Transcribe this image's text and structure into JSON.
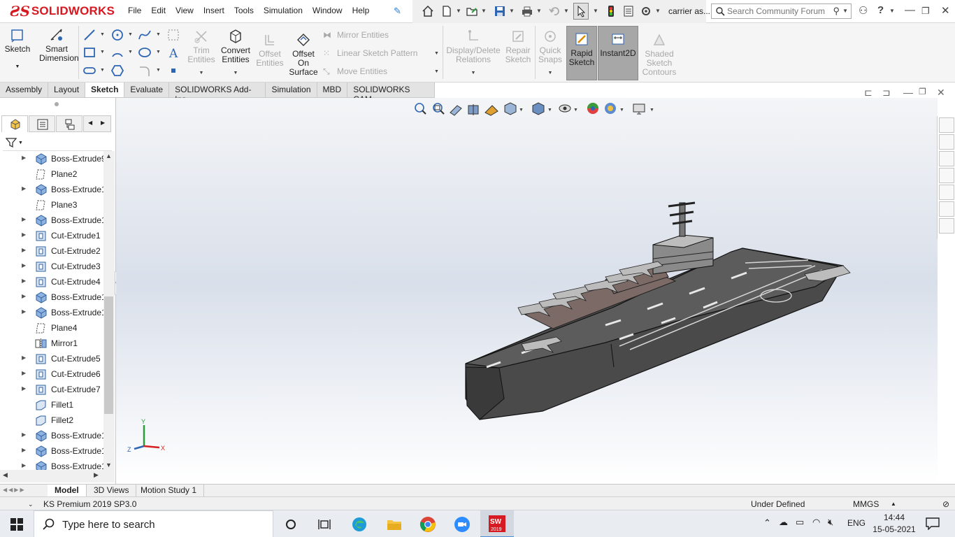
{
  "app": {
    "brand": "SOLIDWORKS",
    "menus": [
      "File",
      "Edit",
      "View",
      "Insert",
      "Tools",
      "Simulation",
      "Window",
      "Help"
    ],
    "document_title": "carrier as...",
    "search_placeholder": "Search Community Forum"
  },
  "command_manager": {
    "sketch": "Sketch",
    "smart_dimension": [
      "Smart",
      "Dimension"
    ],
    "trim_entities": [
      "Trim",
      "Entities"
    ],
    "convert_entities": [
      "Convert",
      "Entities"
    ],
    "offset_entities": [
      "Offset",
      "Entities"
    ],
    "offset_on_surface": [
      "Offset",
      "On",
      "Surface"
    ],
    "mirror_entities": "Mirror Entities",
    "linear_sketch_pattern": "Linear Sketch Pattern",
    "move_entities": "Move Entities",
    "display_delete_relations": [
      "Display/Delete",
      "Relations"
    ],
    "repair_sketch": [
      "Repair",
      "Sketch"
    ],
    "quick_snaps": [
      "Quick",
      "Snaps"
    ],
    "rapid_sketch": [
      "Rapid",
      "Sketch"
    ],
    "instant2d": "Instant2D",
    "shaded_sketch_contours": [
      "Shaded",
      "Sketch",
      "Contours"
    ]
  },
  "tabs": [
    {
      "label": "Assembly",
      "active": false
    },
    {
      "label": "Layout",
      "active": false
    },
    {
      "label": "Sketch",
      "active": true
    },
    {
      "label": "Evaluate",
      "active": false
    },
    {
      "label": "SOLIDWORKS Add-Ins",
      "active": false
    },
    {
      "label": "Simulation",
      "active": false
    },
    {
      "label": "MBD",
      "active": false
    },
    {
      "label": "SOLIDWORKS CAM",
      "active": false
    }
  ],
  "feature_tree": [
    {
      "label": "Boss-Extrude9",
      "type": "boss",
      "expandable": true
    },
    {
      "label": "Plane2",
      "type": "plane",
      "expandable": false
    },
    {
      "label": "Boss-Extrude1",
      "type": "boss",
      "expandable": true
    },
    {
      "label": "Plane3",
      "type": "plane",
      "expandable": false
    },
    {
      "label": "Boss-Extrude1",
      "type": "boss",
      "expandable": true
    },
    {
      "label": "Cut-Extrude1",
      "type": "cut",
      "expandable": true
    },
    {
      "label": "Cut-Extrude2",
      "type": "cut",
      "expandable": true
    },
    {
      "label": "Cut-Extrude3",
      "type": "cut",
      "expandable": true
    },
    {
      "label": "Cut-Extrude4",
      "type": "cut",
      "expandable": true
    },
    {
      "label": "Boss-Extrude1",
      "type": "boss",
      "expandable": true
    },
    {
      "label": "Boss-Extrude1",
      "type": "boss",
      "expandable": true
    },
    {
      "label": "Plane4",
      "type": "plane",
      "expandable": false
    },
    {
      "label": "Mirror1",
      "type": "mirror",
      "expandable": false
    },
    {
      "label": "Cut-Extrude5",
      "type": "cut",
      "expandable": true
    },
    {
      "label": "Cut-Extrude6",
      "type": "cut",
      "expandable": true
    },
    {
      "label": "Cut-Extrude7",
      "type": "cut",
      "expandable": true
    },
    {
      "label": "Fillet1",
      "type": "fillet",
      "expandable": false
    },
    {
      "label": "Fillet2",
      "type": "fillet",
      "expandable": false
    },
    {
      "label": "Boss-Extrude1",
      "type": "boss",
      "expandable": true
    },
    {
      "label": "Boss-Extrude1",
      "type": "boss",
      "expandable": true
    },
    {
      "label": "Boss-Extrude1",
      "type": "boss",
      "expandable": true
    }
  ],
  "triad": {
    "x": "X",
    "y": "Y",
    "z": "Z"
  },
  "bottom_tabs": [
    "Model",
    "3D Views",
    "Motion Study 1"
  ],
  "status": {
    "left": "KS Premium 2019 SP3.0",
    "state": "Under Defined",
    "units": "MMGS"
  },
  "taskbar": {
    "search_placeholder": "Type here to search",
    "language": "ENG",
    "time": "14:44",
    "date": "15-05-2021",
    "sw_badge": "2019"
  },
  "colors": {
    "brand_red": "#d71921",
    "active_tool": "#a7a7a7",
    "hull": "#4a4a4a"
  }
}
